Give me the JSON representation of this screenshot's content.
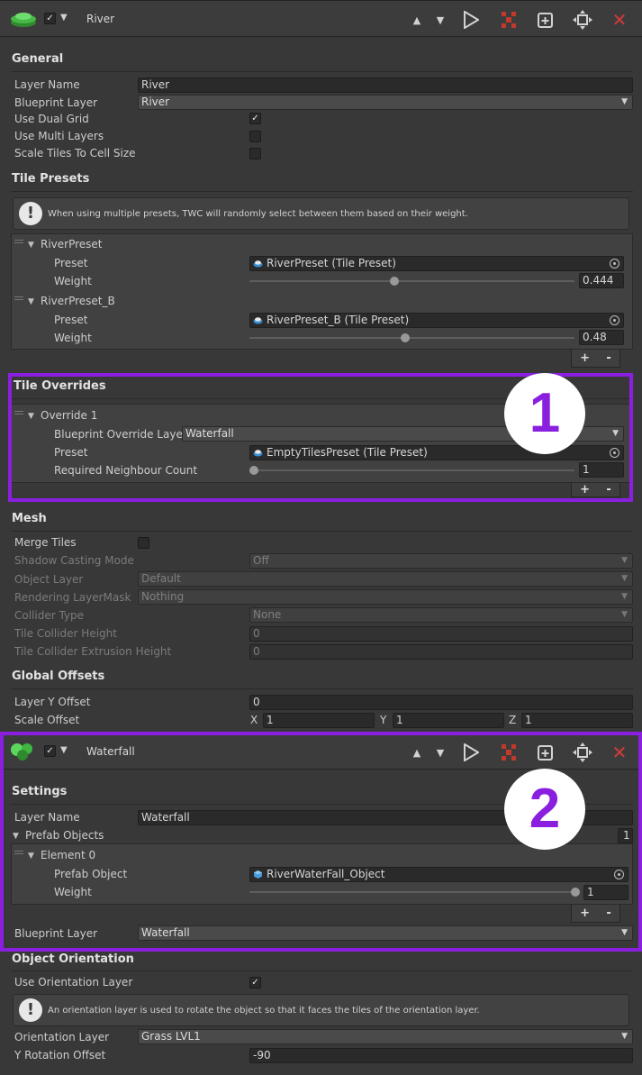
{
  "river_header": {
    "name": "River"
  },
  "general": {
    "title": "General",
    "layer_name_label": "Layer Name",
    "layer_name_value": "River",
    "blueprint_layer_label": "Blueprint Layer",
    "blueprint_layer_value": "River",
    "use_dual_grid_label": "Use Dual Grid",
    "use_dual_grid_checked": "✓",
    "use_multi_layers_label": "Use Multi Layers",
    "scale_tiles_label": "Scale Tiles To Cell Size"
  },
  "tile_presets": {
    "title": "Tile Presets",
    "info": "When using multiple presets, TWC will randomly select between them based on their weight.",
    "items": [
      {
        "name": "RiverPreset",
        "preset_label": "Preset",
        "preset_value": "RiverPreset (Tile Preset)",
        "weight_label": "Weight",
        "weight": "0.444",
        "weight_fraction": 0.444
      },
      {
        "name": "RiverPreset_B",
        "preset_label": "Preset",
        "preset_value": "RiverPreset_B (Tile Preset)",
        "weight_label": "Weight",
        "weight": "0.48",
        "weight_fraction": 0.48
      }
    ],
    "add": "+",
    "remove": "-"
  },
  "tile_overrides": {
    "title": "Tile Overrides",
    "item_name": "Override 1",
    "blueprint_override_label": "Blueprint Override Layer",
    "blueprint_override_value": "Waterfall",
    "preset_label": "Preset",
    "preset_value": "EmptyTilesPreset (Tile Preset)",
    "neighbour_label": "Required Neighbour Count",
    "neighbour_value": "1",
    "add": "+",
    "remove": "-"
  },
  "mesh": {
    "title": "Mesh",
    "merge_tiles_label": "Merge Tiles",
    "shadow_label": "Shadow Casting Mode",
    "shadow_value": "Off",
    "object_layer_label": "Object Layer",
    "object_layer_value": "Default",
    "rendering_mask_label": "Rendering LayerMask",
    "rendering_mask_value": "Nothing",
    "collider_type_label": "Collider Type",
    "collider_type_value": "None",
    "collider_height_label": "Tile Collider Height",
    "collider_height_value": "0",
    "collider_extrusion_label": "Tile Collider Extrusion Height",
    "collider_extrusion_value": "0"
  },
  "global_offsets": {
    "title": "Global Offsets",
    "layer_y_label": "Layer Y Offset",
    "layer_y_value": "0",
    "scale_label": "Scale Offset",
    "x_label": "X",
    "x_value": "1",
    "y_label": "Y",
    "y_value": "1",
    "z_label": "Z",
    "z_value": "1"
  },
  "waterfall_header": {
    "name": "Waterfall"
  },
  "settings": {
    "title": "Settings",
    "layer_name_label": "Layer Name",
    "layer_name_value": "Waterfall",
    "prefab_objects_label": "Prefab Objects",
    "prefab_objects_count": "1",
    "element_name": "Element 0",
    "prefab_object_label": "Prefab Object",
    "prefab_object_value": "RiverWaterFall_Object",
    "weight_label": "Weight",
    "weight_value": "1",
    "weight_fraction": 1.0,
    "add": "+",
    "remove": "-",
    "blueprint_layer_label": "Blueprint Layer",
    "blueprint_layer_value": "Waterfall"
  },
  "object_orientation": {
    "title": "Object Orientation",
    "use_orientation_label": "Use Orientation Layer",
    "use_orientation_checked": "✓",
    "info": "An orientation layer is used to rotate the object so that it faces the tiles of the orientation layer.",
    "orientation_layer_label": "Orientation Layer",
    "orientation_layer_value": "Grass LVL1",
    "y_rotation_label": "Y Rotation Offset",
    "y_rotation_value": "-90"
  },
  "annotations": {
    "marker_1": "1",
    "marker_2": "2",
    "highlight_color": "#8a1fe0"
  }
}
